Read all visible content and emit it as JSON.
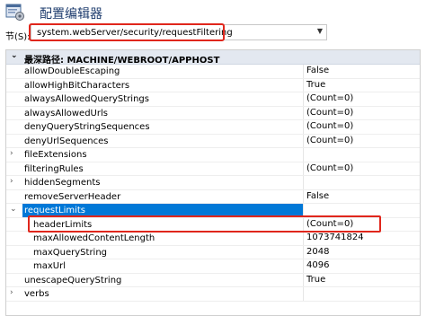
{
  "window": {
    "title": "配置编辑器",
    "icon": "config-editor-icon"
  },
  "section": {
    "label": "节(S):",
    "value": "system.webServer/security/requestFiltering"
  },
  "grid": {
    "header": "最深路径: MACHINE/WEBROOT/APPHOST",
    "rows": [
      {
        "name": "allowDoubleEscaping",
        "value": "False",
        "indent": 0,
        "expander": ""
      },
      {
        "name": "allowHighBitCharacters",
        "value": "True",
        "indent": 0,
        "expander": ""
      },
      {
        "name": "alwaysAllowedQueryStrings",
        "value": "(Count=0)",
        "indent": 0,
        "expander": ""
      },
      {
        "name": "alwaysAllowedUrls",
        "value": "(Count=0)",
        "indent": 0,
        "expander": ""
      },
      {
        "name": "denyQueryStringSequences",
        "value": "(Count=0)",
        "indent": 0,
        "expander": ""
      },
      {
        "name": "denyUrlSequences",
        "value": "(Count=0)",
        "indent": 0,
        "expander": ""
      },
      {
        "name": "fileExtensions",
        "value": "",
        "indent": 0,
        "expander": ">"
      },
      {
        "name": "filteringRules",
        "value": "(Count=0)",
        "indent": 0,
        "expander": ""
      },
      {
        "name": "hiddenSegments",
        "value": "",
        "indent": 0,
        "expander": ">"
      },
      {
        "name": "removeServerHeader",
        "value": "False",
        "indent": 0,
        "expander": ""
      },
      {
        "name": "requestLimits",
        "value": "",
        "indent": 0,
        "expander": "v",
        "selected": true
      },
      {
        "name": "headerLimits",
        "value": "(Count=0)",
        "indent": 1,
        "expander": ""
      },
      {
        "name": "maxAllowedContentLength",
        "value": "1073741824",
        "indent": 1,
        "expander": ""
      },
      {
        "name": "maxQueryString",
        "value": "2048",
        "indent": 1,
        "expander": ""
      },
      {
        "name": "maxUrl",
        "value": "4096",
        "indent": 1,
        "expander": ""
      },
      {
        "name": "unescapeQueryString",
        "value": "True",
        "indent": 0,
        "expander": ""
      },
      {
        "name": "verbs",
        "value": "",
        "indent": 0,
        "expander": ">"
      }
    ]
  },
  "colors": {
    "highlight_box": "#e0261c",
    "selected_row": "#0078d7",
    "header_bg": "#e3e8f0"
  }
}
